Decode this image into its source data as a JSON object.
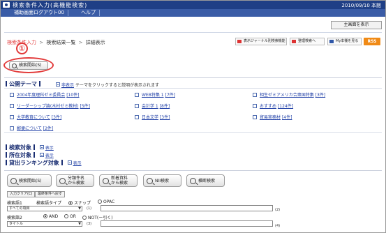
{
  "header": {
    "app_title": "検索条件入力(高機能検索)",
    "date": "2010/09/10 本館",
    "menu": [
      "補助画面ログアウト00",
      "ヘルプ"
    ],
    "main_button": "主画面を表示"
  },
  "breadcrumb": {
    "items": [
      "検索条件入力",
      "検索結果一覧",
      "詳細表示"
    ],
    "separator": ">"
  },
  "toolbar": {
    "buttons": [
      "表示ジャーナル別検索機能",
      "整理検索へ",
      "My本棚を見る"
    ],
    "rss": "RSS"
  },
  "annotation": {
    "number": "①"
  },
  "search_start_top": "検索開始(S)",
  "public_theme": {
    "title": "公開テーマ",
    "expand": "非表示",
    "hint": "テーマをクリックすると説明が表示されます",
    "items": [
      [
        "2004年度理科ゼミ委員会",
        "[10件]"
      ],
      [
        "WEB特集 1",
        "[7件]"
      ],
      [
        "相生ゼミアメリカ合衆国特集",
        "[3件]"
      ],
      [
        "リーダーシップ論(木村ゼミ教材)",
        "[5件]"
      ],
      [
        "会計学 1",
        "[8件]"
      ],
      [
        "おすすめ",
        "[124件]"
      ],
      [
        "大学教育について",
        "[3件]"
      ],
      [
        "日本文学",
        "[3件]"
      ],
      [
        "貿易実務材",
        "[4件]"
      ],
      [
        "郵便について",
        "[2件]"
      ]
    ]
  },
  "filters": [
    {
      "label": "検索対象",
      "link": "表示"
    },
    {
      "label": "所在対象",
      "link": "表示"
    },
    {
      "label": "貸出ランキング対象",
      "link": "表示"
    }
  ],
  "big_buttons": [
    [
      "検索開始(S)"
    ],
    [
      "分類件名",
      "から検索"
    ],
    [
      "新着資料",
      "から検索"
    ],
    [
      "NII検索"
    ],
    [
      "横断検索"
    ]
  ],
  "small_buttons": [
    "入力クリア(C)",
    "最終条件へ戻す"
  ],
  "form": {
    "keyword1_label": "検索語1",
    "type_label": "検索語タイプ",
    "type_options": [
      "スナップ",
      "OPAC"
    ],
    "field1": "すべての項目",
    "paren1": "(1)",
    "paren2": "(2)",
    "keyword2_label": "検索語2",
    "logic_options": [
      "AND",
      "OR",
      "NOT(ー引く)"
    ],
    "field2": "タイトル",
    "paren3": "(3)",
    "paren4": "(4)"
  }
}
